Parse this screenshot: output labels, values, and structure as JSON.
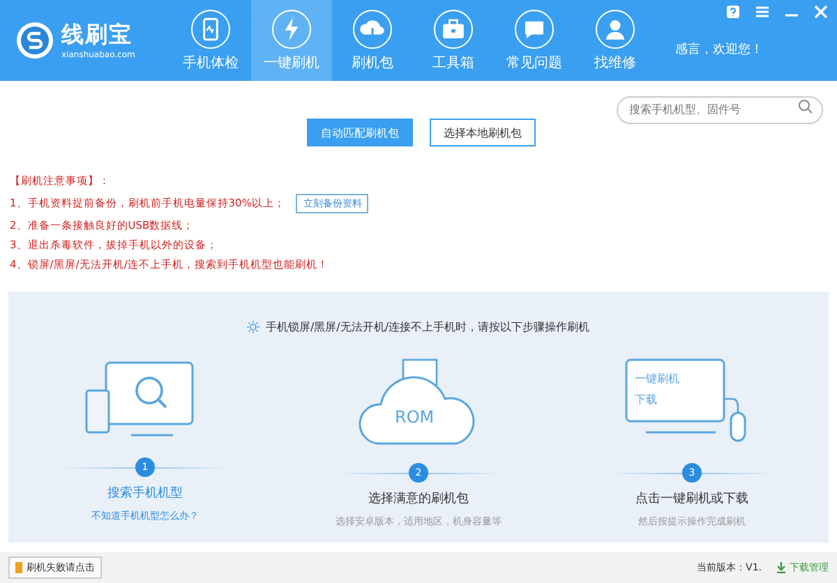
{
  "logo": {
    "name": "线刷宝",
    "domain": "xianshuabao.com"
  },
  "tabs": [
    {
      "label": "手机体检",
      "selected": false
    },
    {
      "label": "一键刷机",
      "selected": true
    },
    {
      "label": "刷机包",
      "selected": false
    },
    {
      "label": "工具箱",
      "selected": false
    },
    {
      "label": "常见问题",
      "selected": false
    },
    {
      "label": "找维修",
      "selected": false
    }
  ],
  "greeting": "感言，欢迎您！",
  "search": {
    "placeholder": "搜索手机机型、固件号"
  },
  "actions": [
    {
      "label": "自动匹配刷机包",
      "selected": true
    },
    {
      "label": "选择本地刷机包",
      "selected": false
    }
  ],
  "notes": {
    "title": "【刷机注意事项】：",
    "items": [
      {
        "text": "1、手机资料提前备份，刷机前手机电量保持30%以上；",
        "button": "立刻备份资料"
      },
      {
        "text": "2、准备一条接触良好的USB数据线；"
      },
      {
        "text": "3、退出杀毒软件，拔掉手机以外的设备；"
      },
      {
        "text": "4、锁屏/黑屏/无法开机/连不上手机，搜索到手机机型也能刷机！"
      }
    ]
  },
  "guide": {
    "tip": "手机锁屏/黑屏/无法开机/连接不上手机时，请按以下步骤操作刷机",
    "steps": [
      {
        "kind": "search",
        "number": "1",
        "title": "搜索手机机型",
        "subtitle": "不知道手机机型怎么办？",
        "link": true
      },
      {
        "kind": "rom",
        "number": "2",
        "illustration_text": "ROM",
        "title": "选择满意的刷机包",
        "subtitle": "选择安卓版本，适用地区，机身容量等",
        "link": false
      },
      {
        "kind": "flash",
        "number": "3",
        "illustration_lines": [
          "一键刷机",
          "下载"
        ],
        "title": "点击一键刷机或下载",
        "subtitle": "然后按提示操作完成刷机",
        "link": false
      }
    ]
  },
  "status_bar": {
    "feedback": "刷机失败请点击",
    "version": "当前版本：V1.",
    "downloads": "下载管理"
  }
}
